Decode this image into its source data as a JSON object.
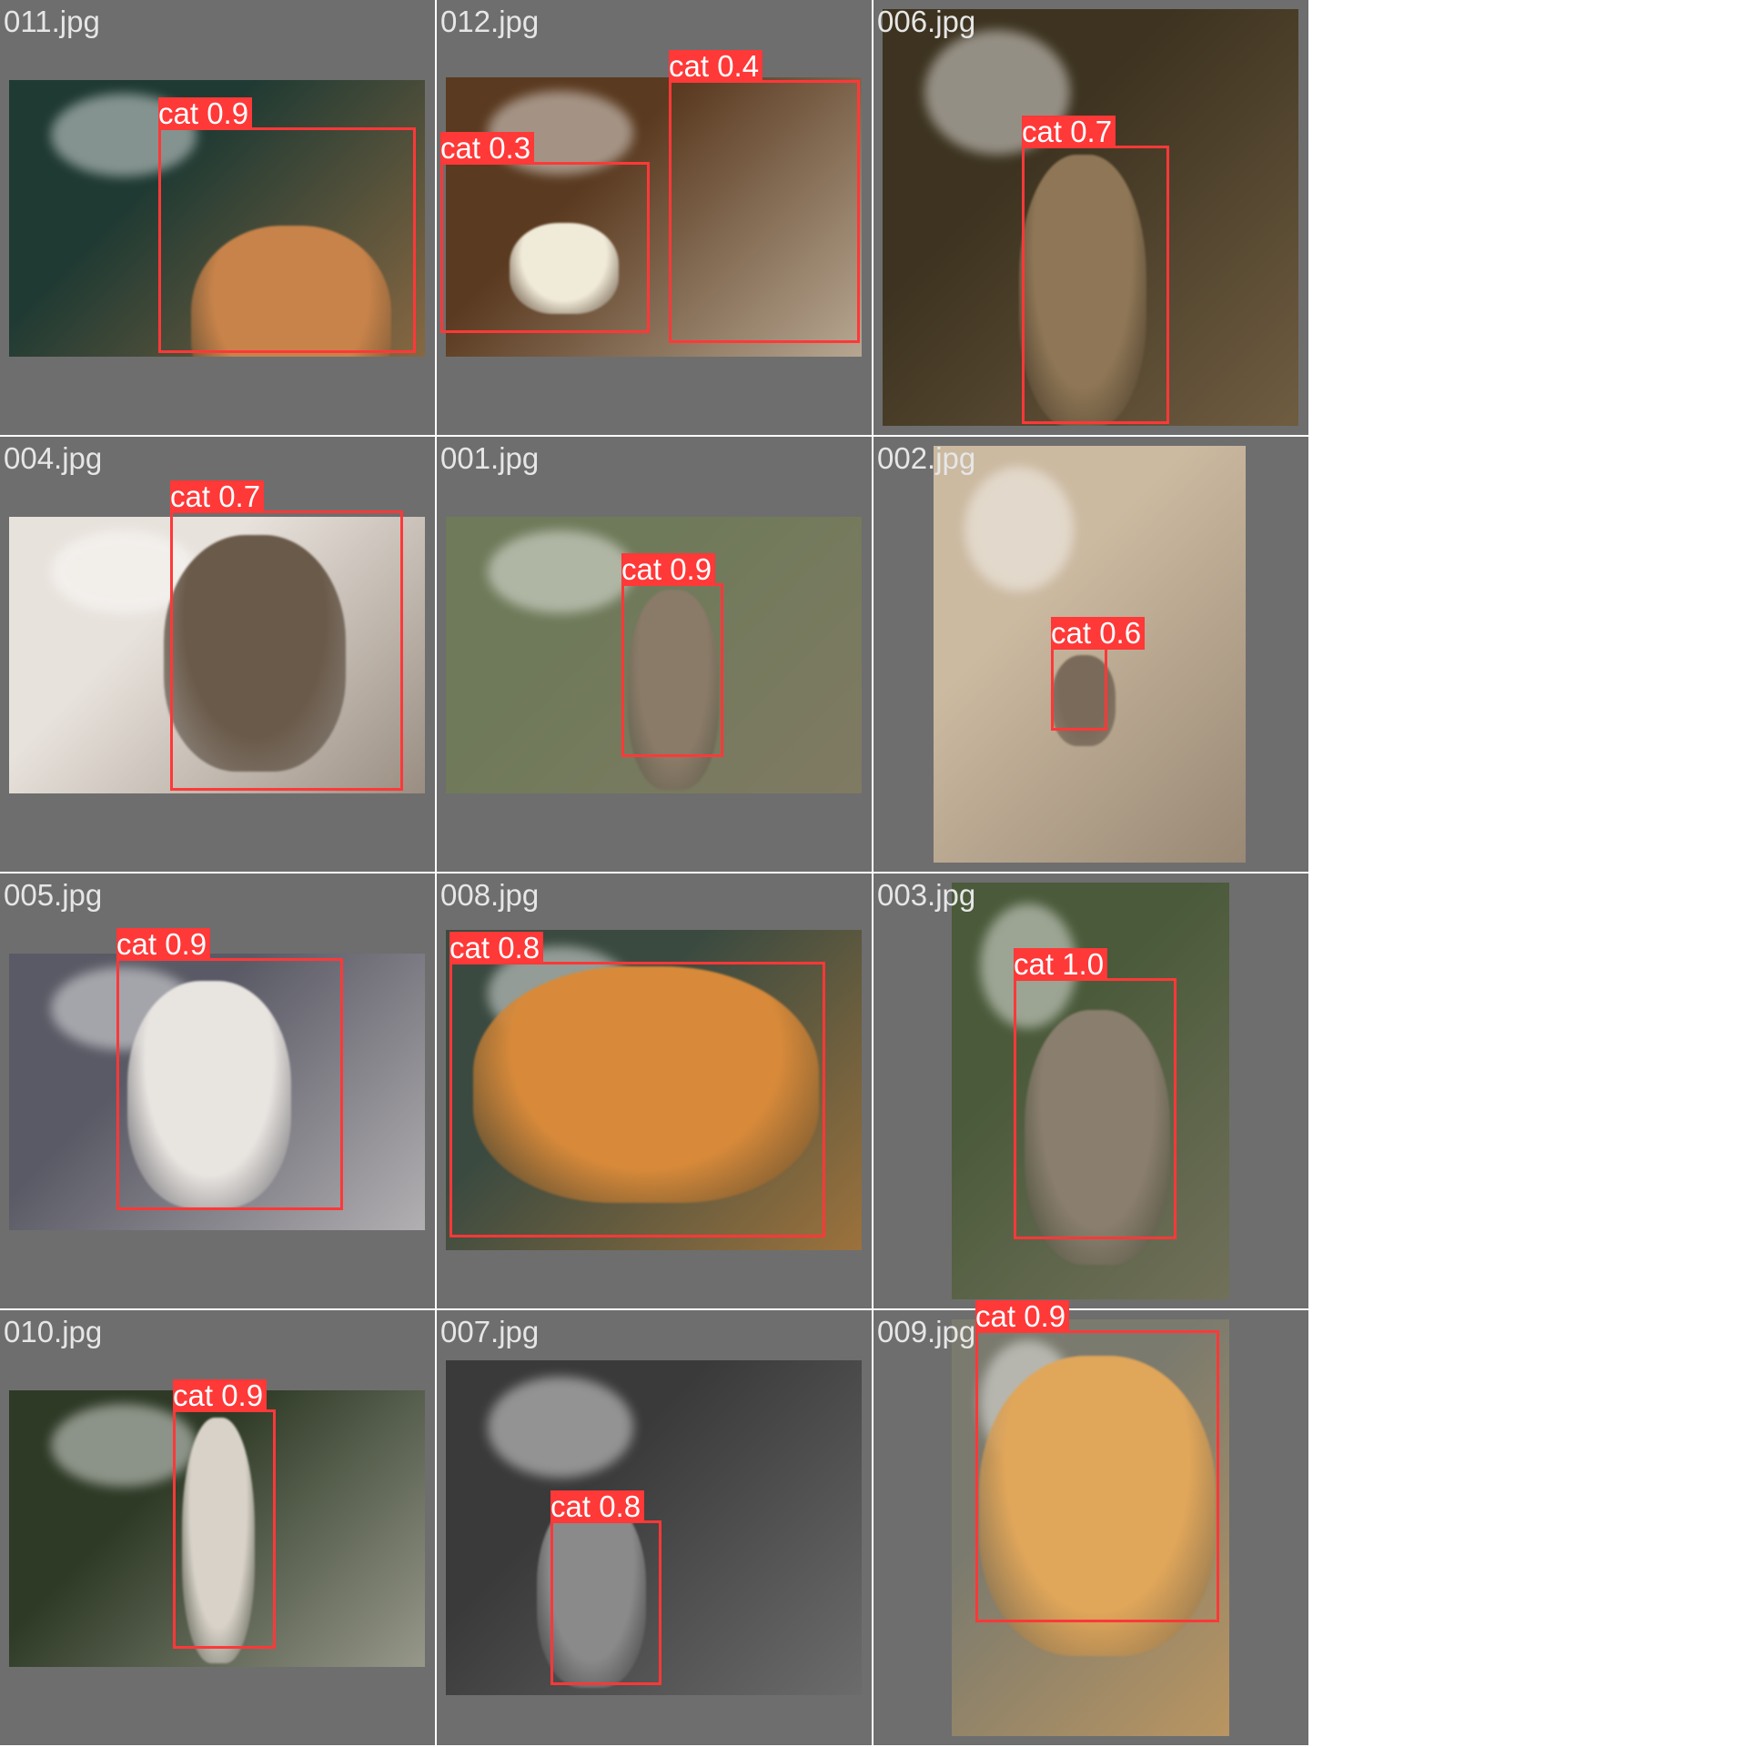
{
  "accent_color": "#ff3838",
  "panel_color": "#6e6e6e",
  "tiles": [
    {
      "filename": "011.jpg",
      "photo_desc_colors": [
        "#1f3a33",
        "#c8834a"
      ],
      "detections": [
        {
          "label": "cat 0.9"
        }
      ]
    },
    {
      "filename": "012.jpg",
      "photo_desc_colors": [
        "#5a3a20",
        "#f0ead8"
      ],
      "detections": [
        {
          "label": "cat 0.4"
        },
        {
          "label": "cat 0.3"
        }
      ]
    },
    {
      "filename": "006.jpg",
      "photo_desc_colors": [
        "#3d3320",
        "#8e7656"
      ],
      "detections": [
        {
          "label": "cat 0.7"
        }
      ]
    },
    {
      "filename": "004.jpg",
      "photo_desc_colors": [
        "#e8e2dc",
        "#6a5a4a"
      ],
      "detections": [
        {
          "label": "cat 0.7"
        }
      ]
    },
    {
      "filename": "001.jpg",
      "photo_desc_colors": [
        "#6f7a5a",
        "#8a7a68"
      ],
      "detections": [
        {
          "label": "cat 0.9"
        }
      ]
    },
    {
      "filename": "002.jpg",
      "photo_desc_colors": [
        "#cbb9a0",
        "#7a6a5a"
      ],
      "detections": [
        {
          "label": "cat 0.6"
        }
      ]
    },
    {
      "filename": "005.jpg",
      "photo_desc_colors": [
        "#5a5a66",
        "#e8e4e0"
      ],
      "detections": [
        {
          "label": "cat 0.9"
        }
      ]
    },
    {
      "filename": "008.jpg",
      "photo_desc_colors": [
        "#3a4a40",
        "#d88a3a"
      ],
      "detections": [
        {
          "label": "cat 0.8"
        }
      ]
    },
    {
      "filename": "003.jpg",
      "photo_desc_colors": [
        "#4a5a3a",
        "#8a7e6e"
      ],
      "detections": [
        {
          "label": "cat 1.0"
        }
      ]
    },
    {
      "filename": "010.jpg",
      "photo_desc_colors": [
        "#2e3a26",
        "#d8d2c8"
      ],
      "detections": [
        {
          "label": "cat 0.9"
        }
      ]
    },
    {
      "filename": "007.jpg",
      "photo_desc_colors": [
        "#3a3a3a",
        "#8a8a8a"
      ],
      "detections": [
        {
          "label": "cat 0.8"
        }
      ]
    },
    {
      "filename": "009.jpg",
      "photo_desc_colors": [
        "#7a7a6e",
        "#e0a65a"
      ],
      "detections": [
        {
          "label": "cat 0.9"
        }
      ]
    }
  ]
}
